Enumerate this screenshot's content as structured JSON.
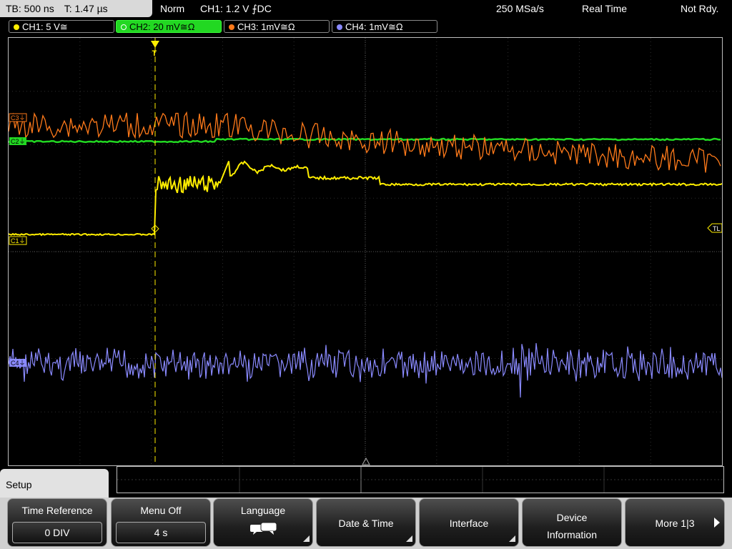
{
  "status": {
    "timebase": "TB: 500 ns",
    "trigger_time": "T: 1.47 µs",
    "acq_mode": "Norm",
    "trigger": "CH1: 1.2 V ⨍DC",
    "sample_rate": "250 MSa/s",
    "acq_type": "Real Time",
    "ready": "Not Rdy."
  },
  "channels": [
    {
      "label": "CH1: 5 V≅",
      "color": "#ffee00"
    },
    {
      "label": "CH2: 20 mV≅Ω",
      "color": "#22d822",
      "active": true
    },
    {
      "label": "CH3: 1mV≅Ω",
      "color": "#ff7a1a"
    },
    {
      "label": "CH4: 1mV≅Ω",
      "color": "#8a8aff"
    }
  ],
  "markers": {
    "c1": "C1⏚",
    "c2": "C2⏚",
    "c3": "C3⏚",
    "c4": "C4⏚",
    "trigger_level": "TL",
    "trigger_pos": "T"
  },
  "menu": {
    "title": "Setup",
    "softkeys": [
      {
        "label": "Time Reference",
        "value": "0 DIV"
      },
      {
        "label": "Menu Off",
        "value": "4 s"
      },
      {
        "label": "Language",
        "icon": "speech-bubble-icon"
      },
      {
        "label": "Date & Time"
      },
      {
        "label": "Interface"
      },
      {
        "label_line1": "Device",
        "label_line2": "Information"
      },
      {
        "label": "More 1|3"
      }
    ]
  }
}
